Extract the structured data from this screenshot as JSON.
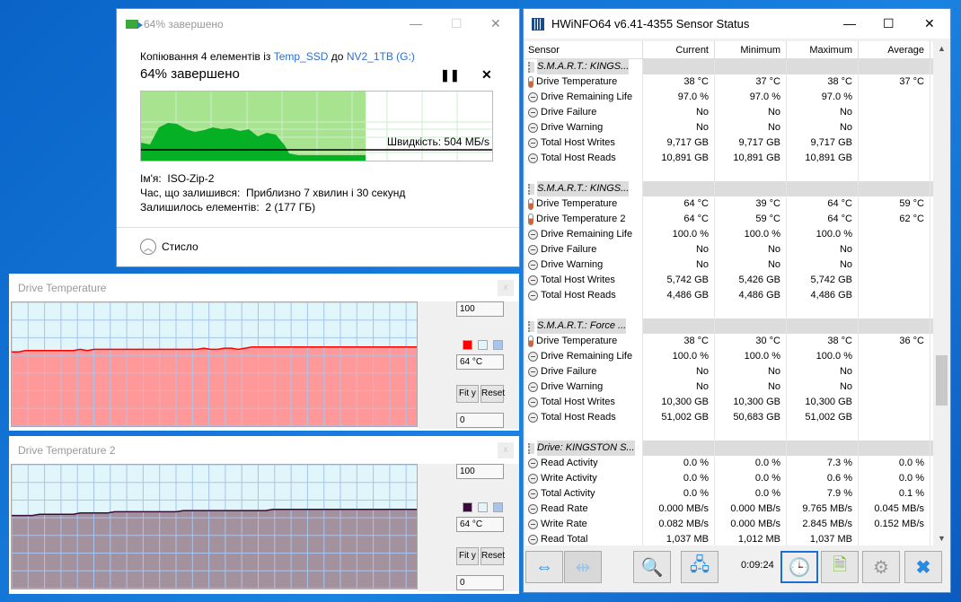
{
  "copy_dialog": {
    "title": "64% завершено",
    "copy_prefix": "Копіювання 4 елементів із",
    "source": "Temp_SSD",
    "to": "до",
    "dest": "NV2_1TB (G:)",
    "progress_label": "64% завершено",
    "progress_percent": 64,
    "speed": "Швидкість: 504 МБ/s",
    "name_label": "Ім'я:",
    "name_value": "ISO-Zip-2",
    "time_label": "Час, що залишився:",
    "time_value": "Приблизно 7 хвилин і 30 секунд",
    "items_label": "Залишилось елементів:",
    "items_value": "2 (177 ГБ)",
    "less_label": "Стисло",
    "colors": {
      "done": "#a8e490",
      "graph": "#06b025"
    }
  },
  "graphs": [
    {
      "title": "Drive Temperature",
      "max": "100",
      "current": "64 °C",
      "min": "0",
      "fit": "Fit y",
      "reset": "Reset",
      "close": "x",
      "line_color": "#ff0000",
      "fill_color": "#ff9999",
      "history": [
        60,
        60,
        61,
        61,
        61,
        61,
        61,
        61,
        61,
        61,
        62,
        61,
        62,
        62,
        62,
        62,
        62,
        62,
        62,
        62,
        62,
        62,
        62,
        62,
        62,
        62,
        62,
        62,
        63,
        62,
        62,
        63,
        63,
        62,
        63,
        64,
        64,
        64,
        64,
        64,
        64,
        64,
        64,
        64,
        64,
        64,
        64,
        64,
        64,
        64,
        64,
        64,
        64,
        64,
        64,
        64,
        64,
        64,
        64,
        64
      ]
    },
    {
      "title": "Drive Temperature 2",
      "max": "100",
      "current": "64 °C",
      "min": "0",
      "fit": "Fit y",
      "reset": "Reset",
      "close": "x",
      "line_color": "#3a0a3a",
      "fill_color": "#a4919e",
      "history": [
        59,
        59,
        59,
        59,
        60,
        60,
        60,
        60,
        60,
        60,
        61,
        61,
        61,
        61,
        61,
        62,
        62,
        62,
        62,
        62,
        62,
        62,
        62,
        62,
        62,
        63,
        63,
        63,
        63,
        63,
        63,
        63,
        63,
        63,
        63,
        63,
        63,
        63,
        64,
        64,
        64,
        64,
        64,
        64,
        64,
        64,
        64,
        64,
        64,
        64,
        64,
        64,
        64,
        64,
        64,
        64,
        64,
        64,
        64,
        64
      ]
    }
  ],
  "hwinfo": {
    "title": "HWiNFO64 v6.41-4355 Sensor Status",
    "columns": [
      "Sensor",
      "Current",
      "Minimum",
      "Maximum",
      "Average"
    ],
    "rows": [
      {
        "t": "g",
        "name": "S.M.A.R.T.: KINGS..."
      },
      {
        "t": "s",
        "i": "t",
        "name": "Drive Temperature",
        "v": [
          "38 °C",
          "37 °C",
          "38 °C",
          "37 °C"
        ]
      },
      {
        "t": "s",
        "name": "Drive Remaining Life",
        "v": [
          "97.0 %",
          "97.0 %",
          "97.0 %",
          ""
        ]
      },
      {
        "t": "s",
        "name": "Drive Failure",
        "v": [
          "No",
          "No",
          "No",
          ""
        ]
      },
      {
        "t": "s",
        "name": "Drive Warning",
        "v": [
          "No",
          "No",
          "No",
          ""
        ]
      },
      {
        "t": "s",
        "name": "Total Host Writes",
        "v": [
          "9,717 GB",
          "9,717 GB",
          "9,717 GB",
          ""
        ]
      },
      {
        "t": "s",
        "name": "Total Host Reads",
        "v": [
          "10,891 GB",
          "10,891 GB",
          "10,891 GB",
          ""
        ]
      },
      {
        "t": "b"
      },
      {
        "t": "g",
        "name": "S.M.A.R.T.: KINGS..."
      },
      {
        "t": "s",
        "i": "t",
        "name": "Drive Temperature",
        "v": [
          "64 °C",
          "39 °C",
          "64 °C",
          "59 °C"
        ]
      },
      {
        "t": "s",
        "i": "t",
        "name": "Drive Temperature 2",
        "v": [
          "64 °C",
          "59 °C",
          "64 °C",
          "62 °C"
        ]
      },
      {
        "t": "s",
        "name": "Drive Remaining Life",
        "v": [
          "100.0 %",
          "100.0 %",
          "100.0 %",
          ""
        ]
      },
      {
        "t": "s",
        "name": "Drive Failure",
        "v": [
          "No",
          "No",
          "No",
          ""
        ]
      },
      {
        "t": "s",
        "name": "Drive Warning",
        "v": [
          "No",
          "No",
          "No",
          ""
        ]
      },
      {
        "t": "s",
        "name": "Total Host Writes",
        "v": [
          "5,742 GB",
          "5,426 GB",
          "5,742 GB",
          ""
        ]
      },
      {
        "t": "s",
        "name": "Total Host Reads",
        "v": [
          "4,486 GB",
          "4,486 GB",
          "4,486 GB",
          ""
        ]
      },
      {
        "t": "b"
      },
      {
        "t": "g",
        "name": "S.M.A.R.T.: Force ..."
      },
      {
        "t": "s",
        "i": "t",
        "name": "Drive Temperature",
        "v": [
          "38 °C",
          "30 °C",
          "38 °C",
          "36 °C"
        ]
      },
      {
        "t": "s",
        "name": "Drive Remaining Life",
        "v": [
          "100.0 %",
          "100.0 %",
          "100.0 %",
          ""
        ]
      },
      {
        "t": "s",
        "name": "Drive Failure",
        "v": [
          "No",
          "No",
          "No",
          ""
        ]
      },
      {
        "t": "s",
        "name": "Drive Warning",
        "v": [
          "No",
          "No",
          "No",
          ""
        ]
      },
      {
        "t": "s",
        "name": "Total Host Writes",
        "v": [
          "10,300 GB",
          "10,300 GB",
          "10,300 GB",
          ""
        ]
      },
      {
        "t": "s",
        "name": "Total Host Reads",
        "v": [
          "51,002 GB",
          "50,683 GB",
          "51,002 GB",
          ""
        ]
      },
      {
        "t": "b"
      },
      {
        "t": "g",
        "name": "Drive: KINGSTON S..."
      },
      {
        "t": "s",
        "name": "Read Activity",
        "v": [
          "0.0 %",
          "0.0 %",
          "7.3 %",
          "0.0 %"
        ]
      },
      {
        "t": "s",
        "name": "Write Activity",
        "v": [
          "0.0 %",
          "0.0 %",
          "0.6 %",
          "0.0 %"
        ]
      },
      {
        "t": "s",
        "name": "Total Activity",
        "v": [
          "0.0 %",
          "0.0 %",
          "7.9 %",
          "0.1 %"
        ]
      },
      {
        "t": "s",
        "name": "Read Rate",
        "v": [
          "0.000 MB/s",
          "0.000 MB/s",
          "9.765 MB/s",
          "0.045 MB/s"
        ]
      },
      {
        "t": "s",
        "name": "Write Rate",
        "v": [
          "0.082 MB/s",
          "0.000 MB/s",
          "2.845 MB/s",
          "0.152 MB/s"
        ]
      },
      {
        "t": "s",
        "name": "Read Total",
        "v": [
          "1,037 MB",
          "1,012 MB",
          "1,037 MB",
          ""
        ]
      }
    ],
    "timer": "0:09:24"
  }
}
